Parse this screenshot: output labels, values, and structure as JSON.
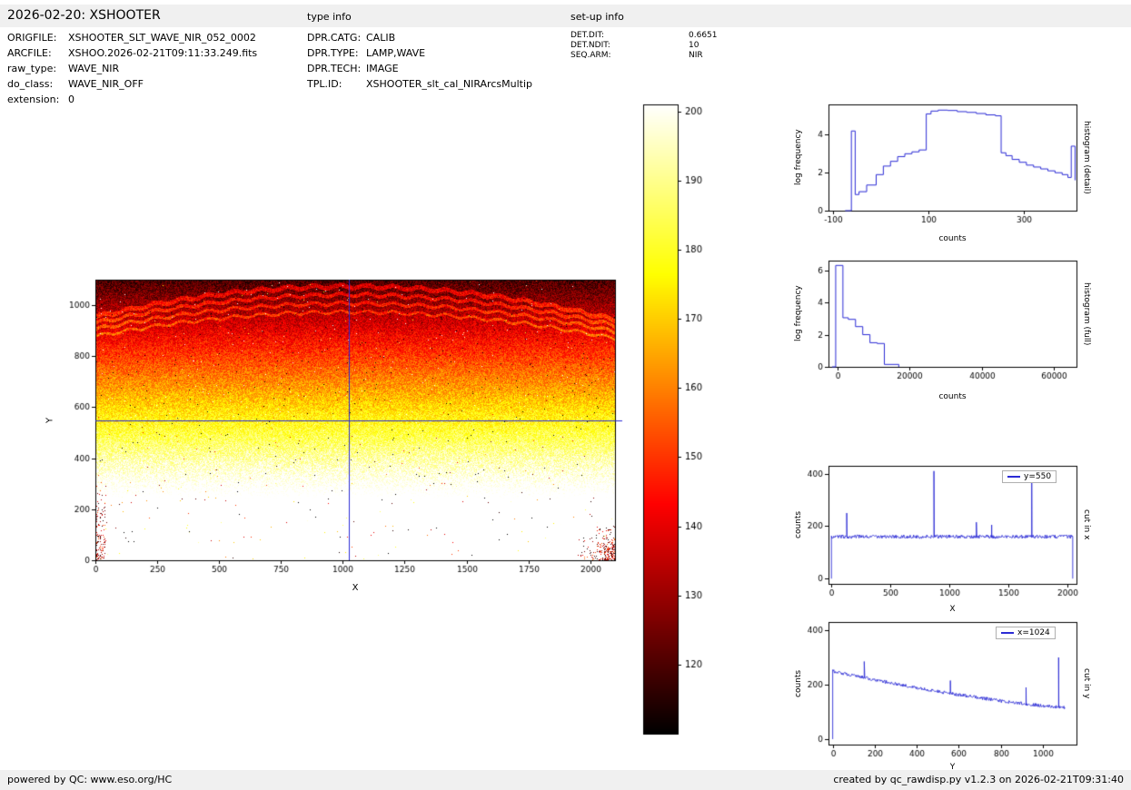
{
  "header": {
    "title": "2026-02-20: XSHOOTER",
    "type_info_label": "type info",
    "setup_info_label": "set-up info"
  },
  "file_info": {
    "rows": [
      {
        "label": "ORIGFILE:",
        "value": "XSHOOTER_SLT_WAVE_NIR_052_0002"
      },
      {
        "label": "ARCFILE:",
        "value": "XSHOO.2026-02-21T09:11:33.249.fits"
      },
      {
        "label": "raw_type:",
        "value": "WAVE_NIR"
      },
      {
        "label": "do_class:",
        "value": "WAVE_NIR_OFF"
      },
      {
        "label": "extension:",
        "value": "0"
      }
    ]
  },
  "type_info": {
    "rows": [
      {
        "label": "DPR.CATG:",
        "value": "CALIB"
      },
      {
        "label": "DPR.TYPE:",
        "value": "LAMP,WAVE"
      },
      {
        "label": "DPR.TECH:",
        "value": "IMAGE"
      },
      {
        "label": "TPL.ID:",
        "value": "XSHOOTER_slt_cal_NIRArcsMultip"
      }
    ]
  },
  "setup_info": {
    "rows": [
      {
        "label": "DET.DIT:",
        "value": "0.6651"
      },
      {
        "label": "DET.NDIT:",
        "value": "10"
      },
      {
        "label": "SEQ.ARM:",
        "value": "NIR"
      }
    ]
  },
  "footer": {
    "left": "powered by QC: www.eso.org/HC",
    "right": "created by qc_rawdisp.py v1.2.3 on 2026-02-21T09:31:40"
  },
  "colors": {
    "accent_blue": "#2b2bd5",
    "bar_bg": "#f0f0f0",
    "axis_black": "#000000"
  },
  "chart_data": [
    {
      "id": "detector_image",
      "type": "heatmap",
      "xlabel": "X",
      "ylabel": "Y",
      "xlim": [
        0,
        2100
      ],
      "ylim": [
        0,
        1100
      ],
      "xticks": [
        0,
        250,
        500,
        750,
        1000,
        1250,
        1500,
        1750,
        2000
      ],
      "yticks": [
        0,
        200,
        400,
        600,
        800,
        1000
      ],
      "colormap": "hot (black-red-yellow-white)",
      "value_model": {
        "counts_at_y0": 235,
        "counts_slope_per_y": -0.105,
        "noise": 4.5
      },
      "crosshair": {
        "x": 1024,
        "y": 550
      },
      "arc_bands": [
        {
          "apex": 1075,
          "drop": 120,
          "halfwidth": 9
        },
        {
          "apex": 1042,
          "drop": 110,
          "halfwidth": 7
        },
        {
          "apex": 1008,
          "drop": 100,
          "halfwidth": 6
        },
        {
          "apex": 975,
          "drop": 95,
          "halfwidth": 5
        }
      ],
      "corner_artifacts": [
        "bottom-left speckle cluster",
        "bottom-right speckle cluster"
      ]
    },
    {
      "id": "colorbar",
      "type": "colorbar",
      "ticks": [
        120,
        130,
        140,
        150,
        160,
        170,
        180,
        190,
        200
      ],
      "vmin": 110,
      "vmax": 201,
      "colormap": "hot (black-red-yellow-white)"
    },
    {
      "id": "histogram_detail",
      "type": "line",
      "right_label": "histogram (detail)",
      "xlabel": "counts",
      "ylabel": "log frequency",
      "xlim": [
        -110,
        410
      ],
      "ylim": [
        0,
        5.6
      ],
      "xticks": [
        -100,
        100,
        300
      ],
      "yticks": [
        0,
        2,
        4
      ],
      "steps_x": [
        -75,
        -62,
        -54,
        -46,
        -30,
        -10,
        5,
        20,
        35,
        50,
        65,
        80,
        95,
        105,
        120,
        140,
        160,
        180,
        200,
        220,
        240,
        252,
        262,
        275,
        290,
        305,
        320,
        335,
        350,
        365,
        380,
        392,
        399,
        407
      ],
      "steps_y": [
        0,
        4.2,
        0.85,
        1.0,
        1.35,
        1.9,
        2.35,
        2.6,
        2.85,
        3.0,
        3.1,
        3.2,
        5.1,
        5.25,
        5.3,
        5.28,
        5.22,
        5.18,
        5.12,
        5.05,
        5.0,
        3.05,
        2.9,
        2.7,
        2.55,
        2.4,
        2.3,
        2.2,
        2.1,
        2.0,
        1.9,
        1.75,
        3.4,
        1.6
      ]
    },
    {
      "id": "histogram_full",
      "type": "line",
      "right_label": "histogram (full)",
      "xlabel": "counts",
      "ylabel": "log frequency",
      "xlim": [
        -2500,
        66300
      ],
      "ylim": [
        0,
        6.6
      ],
      "xticks": [
        0,
        20000,
        40000,
        60000
      ],
      "yticks": [
        0,
        2,
        4,
        6
      ],
      "steps_x": [
        -1500,
        -500,
        1500,
        3000,
        5000,
        7000,
        9000,
        11000,
        13000,
        17000
      ],
      "steps_y": [
        0,
        6.3,
        3.05,
        2.95,
        2.5,
        2.0,
        1.5,
        1.45,
        0.15,
        0
      ]
    },
    {
      "id": "cut_in_x",
      "type": "line",
      "right_label": "cut in x",
      "legend": "y=550",
      "xlabel": "X",
      "ylabel": "counts",
      "xlim": [
        -25,
        2080
      ],
      "ylim": [
        -20,
        430
      ],
      "xticks": [
        0,
        500,
        1000,
        1500,
        2000
      ],
      "yticks": [
        0,
        200,
        400
      ],
      "x_range": [
        0,
        2048
      ],
      "baseline": 160,
      "noise": 7,
      "end_drop": true,
      "spikes": [
        {
          "x": 130,
          "y": 250
        },
        {
          "x": 870,
          "y": 410
        },
        {
          "x": 1230,
          "y": 215
        },
        {
          "x": 1360,
          "y": 205
        },
        {
          "x": 1700,
          "y": 405
        }
      ]
    },
    {
      "id": "cut_in_y",
      "type": "line",
      "right_label": "cut in y",
      "legend": "x=1024",
      "xlabel": "Y",
      "ylabel": "counts",
      "xlim": [
        -20,
        1160
      ],
      "ylim": [
        -20,
        430
      ],
      "xticks": [
        0,
        200,
        400,
        600,
        800,
        1000
      ],
      "yticks": [
        0,
        200,
        400
      ],
      "x_range": [
        0,
        1105
      ],
      "trend": [
        [
          0,
          250
        ],
        [
          200,
          218
        ],
        [
          400,
          188
        ],
        [
          600,
          163
        ],
        [
          800,
          140
        ],
        [
          1000,
          122
        ],
        [
          1105,
          116
        ]
      ],
      "noise": 6,
      "end_drop": false,
      "spikes": [
        {
          "x": 150,
          "y": 285
        },
        {
          "x": 560,
          "y": 215
        },
        {
          "x": 920,
          "y": 190
        },
        {
          "x": 1075,
          "y": 300
        }
      ]
    }
  ]
}
